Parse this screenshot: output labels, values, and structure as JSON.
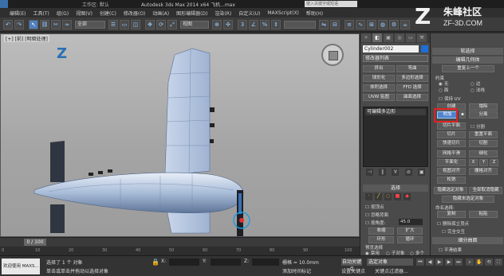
{
  "titlebar": {
    "workspace": "工作区: 默认",
    "title": "Autodesk 3ds Max  2014 x64    飞机...max",
    "search_placeholder": "键入关键字或短语"
  },
  "menubar": {
    "items": [
      "编辑(E)",
      "工具(T)",
      "组(G)",
      "视图(V)",
      "创建(C)",
      "修改器(O)",
      "动画(A)",
      "图形编辑器(D)",
      "渲染(R)",
      "自定义(U)",
      "MAXScript(X)",
      "帮助(H)"
    ]
  },
  "toolbar": {
    "filter_select": "全部",
    "view_select": "视图"
  },
  "logo": {
    "mark": "Z",
    "name_cn": "朱峰社区",
    "url": "ZF-3D.COM"
  },
  "viewport": {
    "label": "[+] [前] [明暗处理]",
    "axis_letter": "Z"
  },
  "timeline": {
    "frame": "0 / 100",
    "ticks": [
      "0",
      "10",
      "20",
      "30",
      "40",
      "50",
      "60",
      "70",
      "80",
      "90",
      "100"
    ]
  },
  "statusbar": {
    "maxscript": "欢迎使用 MAXS...",
    "selection": "选择了 1 个 对象",
    "prompt": "单击或单击并拖动以选择对象",
    "x_label": "X:",
    "y_label": "Y:",
    "z_label": "Z:",
    "grid": "栅格 = 10.0mm",
    "add_tag": "添加时间标记",
    "auto_key": "自动关键点",
    "set_key": "设置关键点",
    "selection_set": "选定对象",
    "key_filter": "关键点过滤器..."
  },
  "command_panel": {
    "tabs": [
      "+",
      "◧",
      "▣",
      "◎",
      "▭",
      "⚒"
    ],
    "object_name": "Cylinder002",
    "object_color": "#1d6fd6",
    "modifier_list": "修改器列表",
    "buttons": [
      "挤出",
      "弯曲",
      "球形化",
      "多边形选择",
      "体积选择",
      "FFD 选择",
      "UVW 贴图",
      "曲面选择"
    ],
    "stack_entry": "可编辑多边形",
    "stack_icons": [
      "⊣",
      "‖",
      "∀",
      "⊘",
      "▣"
    ],
    "select_rollout": "选择",
    "by_vertex": "按顶点",
    "ignore_back": "忽略背面",
    "by_angle": "按角度:",
    "angle_value": "45.0",
    "shrink": "收缩",
    "grow": "扩大",
    "ring": "环形",
    "loop": "循环",
    "preview_select": "预览选择",
    "disable": "禁用",
    "subobject": "子对象",
    "multi": "多个"
  },
  "right_panel": {
    "soft_selection": "软选择",
    "edit_geometry": "编辑几何体",
    "repeat_last": "重复上一个",
    "constraints": "约束",
    "none": "无",
    "edge": "边",
    "face": "面",
    "normal": "法线",
    "preserve_uv": "保持 UV",
    "create": "创建",
    "collapse": "塌陷",
    "attach": "附加",
    "detach": "分离",
    "slice_plane": "切片平面",
    "split": "分割",
    "slice": "切片",
    "reset_plane": "重置平面",
    "quickslice": "快速切片",
    "cut": "切割",
    "msmooth": "网格平滑",
    "tessellate": "细化",
    "planarize": "平面化",
    "x": "X",
    "y": "Y",
    "z": "Z",
    "view_align": "视图对齐",
    "grid_align": "栅格对齐",
    "relax": "松弛",
    "hide_selected": "隐藏选定对象",
    "unhide_all": "全部取消隐藏",
    "hide_unselected": "隐藏未选定对象",
    "named_selections": "命名选择:",
    "copy": "复制",
    "paste": "粘贴",
    "delete_isolated": "删除孤立顶点",
    "full_interactivity": "完全交互",
    "subdivision_surface": "细分曲面",
    "smooth_result": "平滑结果"
  }
}
